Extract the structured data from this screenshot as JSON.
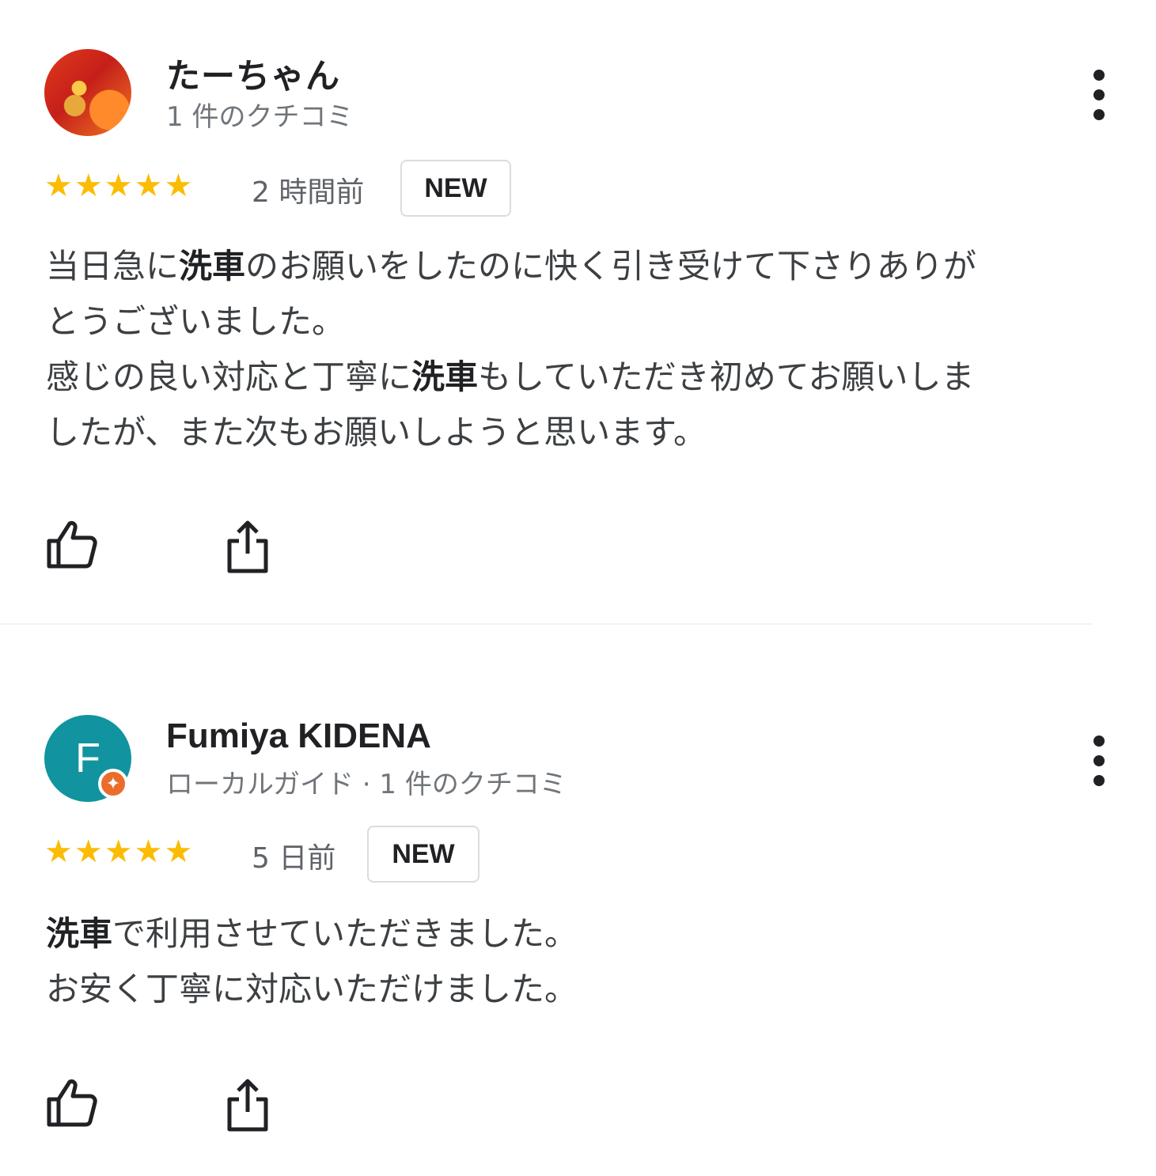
{
  "reviews": [
    {
      "name": "たーちゃん",
      "meta": "1 件のクチコミ",
      "stars": "★★★★★",
      "rating": 5,
      "time": "2 時間前",
      "badge": "NEW",
      "avatar_letter": "",
      "lines": [
        [
          "当日急に",
          "洗車",
          "のお願いをしたのに快く引き受けて下さりありが"
        ],
        [
          "とうございました。",
          "",
          ""
        ],
        [
          "感じの良い対応と丁寧に",
          "洗車",
          "もしていただき初めてお願いしま"
        ],
        [
          "したが、また次もお願いしようと思います。",
          "",
          ""
        ]
      ]
    },
    {
      "name": "Fumiya KIDENA",
      "meta": "ローカルガイド · 1 件のクチコミ",
      "stars": "★★★★★",
      "rating": 5,
      "time": "5 日前",
      "badge": "NEW",
      "avatar_letter": "F",
      "lines": [
        [
          "",
          "洗車",
          "で利用させていただきました。"
        ],
        [
          "お安く丁寧に対応いただけました。",
          "",
          ""
        ]
      ]
    }
  ],
  "icons": {
    "avatar1": "profile-photo-icon",
    "guide_badge": "local-guide-star-icon",
    "more": "more-vert-icon",
    "like": "thumb-up-icon",
    "share": "share-icon"
  },
  "colors": {
    "star": "#fbbc04",
    "avatar2_bg": "#11949f",
    "guide_badge": "#ea6d2c"
  }
}
